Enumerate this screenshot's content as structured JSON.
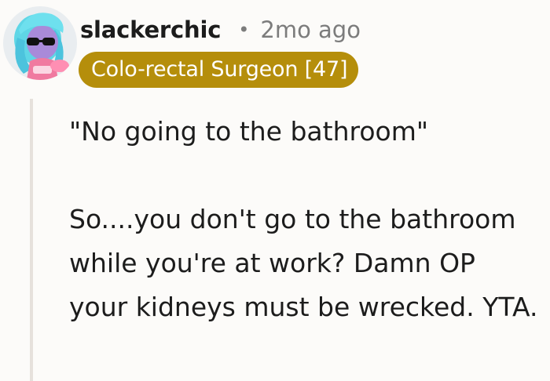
{
  "comment": {
    "username": "slackerchic",
    "separator": "•",
    "timestamp": "2mo ago",
    "flair": "Colo-rectal Surgeon [47]",
    "paragraphs": [
      "\"No going to the bathroom\"",
      "So....you don't go to the bathroom while you're at work? Damn OP your kidneys must be wrecked. YTA."
    ]
  },
  "colors": {
    "flair_background": "#b58e0b",
    "flair_text": "#ffffff",
    "username": "#1c1c1c",
    "meta_text": "#7c7c7c",
    "thread_line": "#e6e1dc",
    "background": "#fcfbf9"
  },
  "icons": {
    "avatar": "snoo-avatar-with-cyan-hair-and-sunglasses"
  }
}
